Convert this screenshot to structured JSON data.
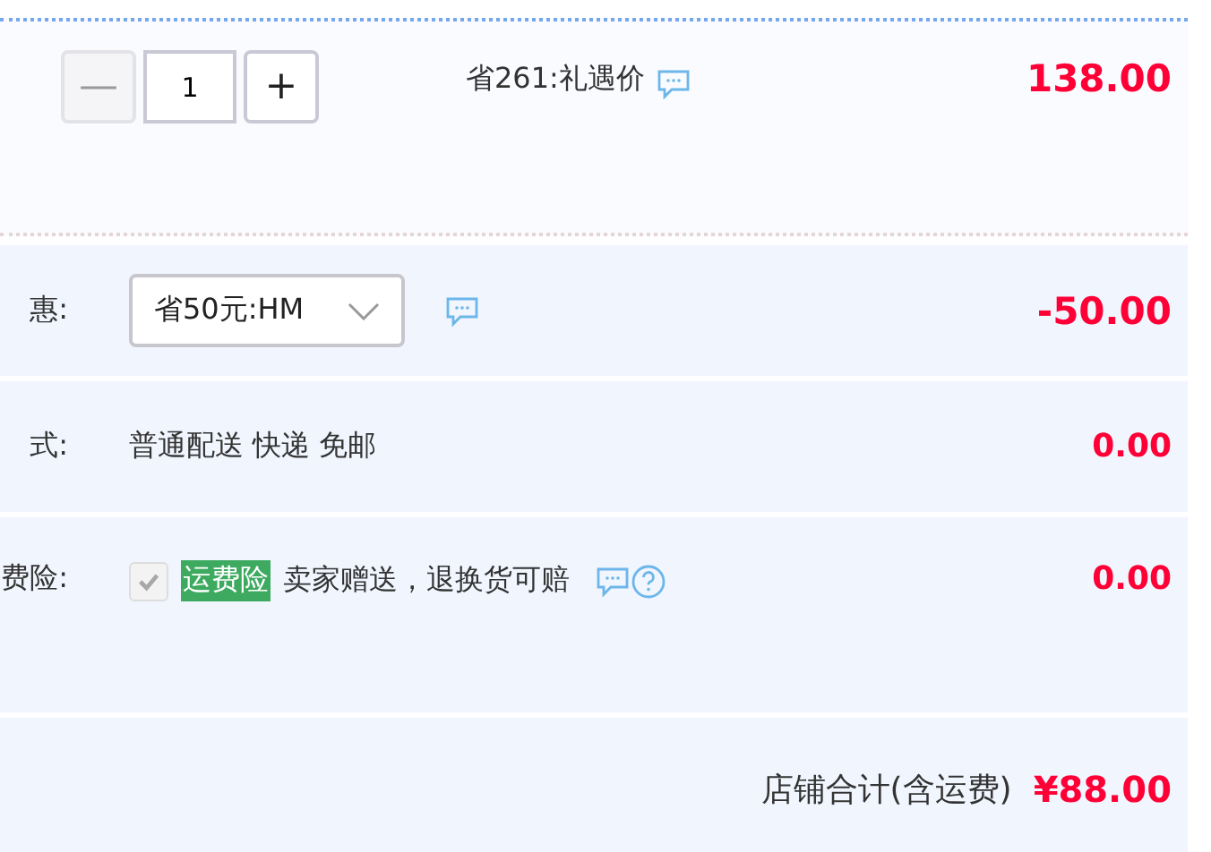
{
  "item": {
    "quantity": "1",
    "minus": {
      "label": "—",
      "disabled": true
    },
    "plus": {
      "label": "+",
      "disabled": false
    },
    "promo": "省261:礼遇价",
    "price": "138.00"
  },
  "rows": [
    {
      "kind": "select",
      "label": "惠:",
      "value": "省50元:HM",
      "amount": "-50.00"
    },
    {
      "kind": "text",
      "label": "式:",
      "value": "普通配送 快递 免邮",
      "amount": "0.00"
    },
    {
      "kind": "insurance",
      "label": "费险:",
      "checked": true,
      "disabled": true,
      "tag": "运费险",
      "value": "卖家赠送，退换货可赔",
      "amount": "0.00"
    }
  ],
  "total": {
    "label": "店铺合计(含运费)",
    "amount": "¥88.00"
  }
}
